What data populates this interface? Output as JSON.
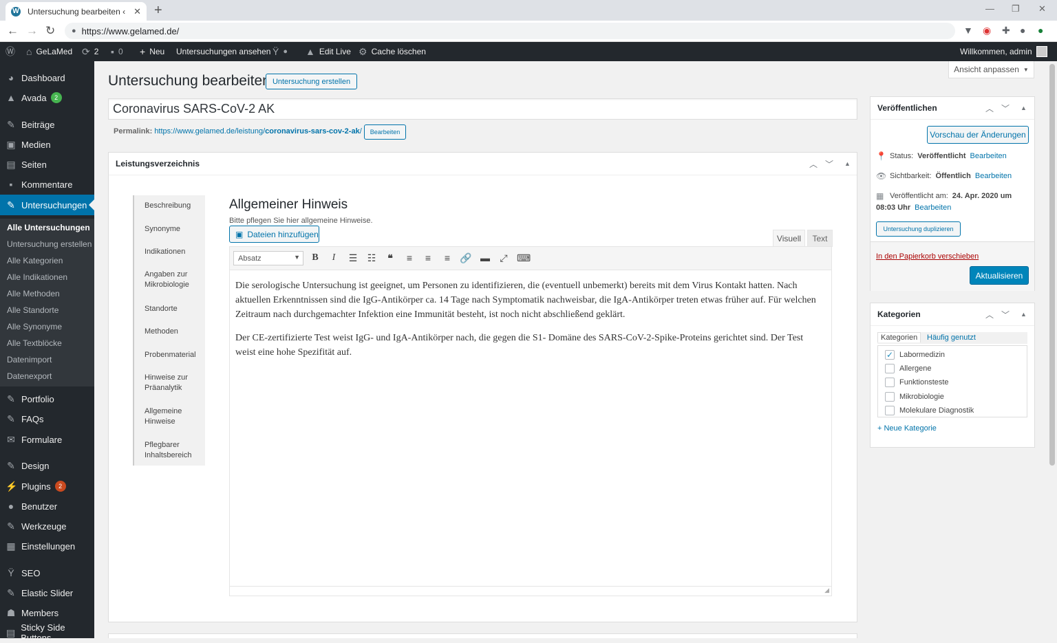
{
  "browser": {
    "tab_title": "Untersuchung bearbeiten ‹ GeLaMed",
    "tab_close": "✕",
    "new_tab": "+",
    "url": "https://www.gelamed.de/"
  },
  "adminbar": {
    "site_name": "GeLaMed",
    "updates_count": "2",
    "comments_count": "0",
    "new_label": "Neu",
    "view_label": "Untersuchungen ansehen",
    "edit_live_label": "Edit Live",
    "cache_label": "Cache löschen",
    "welcome": "Willkommen, admin"
  },
  "sidebar": {
    "dashboard": "Dashboard",
    "avada": "Avada",
    "avada_badge": "2",
    "beitraege": "Beiträge",
    "medien": "Medien",
    "seiten": "Seiten",
    "kommentare": "Kommentare",
    "untersuchungen": "Untersuchungen",
    "submenu": [
      "Alle Untersuchungen",
      "Untersuchung erstellen",
      "Alle Kategorien",
      "Alle Indikationen",
      "Alle Methoden",
      "Alle Standorte",
      "Alle Synonyme",
      "Alle Textblöcke",
      "Datenimport",
      "Datenexport"
    ],
    "portfolio": "Portfolio",
    "faqs": "FAQs",
    "formulare": "Formulare",
    "design": "Design",
    "plugins": "Plugins",
    "plugins_badge": "2",
    "benutzer": "Benutzer",
    "werkzeuge": "Werkzeuge",
    "einstellungen": "Einstellungen",
    "seo": "SEO",
    "elastic_slider": "Elastic Slider",
    "members": "Members",
    "sticky": "Sticky Side Buttons"
  },
  "screen_options": "Ansicht anpassen",
  "page": {
    "title": "Untersuchung bearbeiten",
    "add_new": "Untersuchung erstellen",
    "post_title": "Coronavirus SARS-CoV-2 AK",
    "permalink_label": "Permalink:",
    "permalink_base": "https://www.gelamed.de/leistung/",
    "permalink_slug": "coronavirus-sars-cov-2-ak",
    "permalink_end": "/",
    "permalink_edit": "Bearbeiten"
  },
  "metabox": {
    "title": "Leistungsverzeichnis",
    "tabs": [
      "Beschreibung",
      "Synonyme",
      "Indikationen",
      "Angaben zur Mikrobiologie",
      "Standorte",
      "Methoden",
      "Probenmaterial",
      "Hinweise zur Präanalytik",
      "Allgemeine Hinweise",
      "Pflegbarer Inhaltsbereich"
    ],
    "section_title": "Allgemeiner Hinweis",
    "section_desc": "Bitte pflegen Sie hier allgemeine Hinweise.",
    "add_media": "Dateien hinzufügen",
    "tab_visual": "Visuell",
    "tab_text": "Text",
    "format_select": "Absatz",
    "paragraph1": "Die serologische Untersuchung ist geeignet, um Personen zu identifizieren, die (eventuell unbemerkt) bereits mit dem Virus Kontakt hatten. Nach aktuellen Erkenntnissen sind die IgG-Antikörper ca. 14 Tage nach Symptomatik nachweisbar, die IgA-Antikörper treten etwas früher auf. Für welchen Zeitraum nach durchgemachter Infektion eine Immunität besteht, ist noch nicht abschließend geklärt.",
    "paragraph2": "Der CE-zertifizierte Test weist IgG- und IgA-Antikörper nach, die gegen die S1- Domäne des SARS-CoV-2-Spike-Proteins gerichtet sind. Der Test weist eine hohe Spezifität auf."
  },
  "publish": {
    "title": "Veröffentlichen",
    "preview": "Vorschau der Änderungen",
    "status_label": "Status:",
    "status_value": "Veröffentlicht",
    "visibility_label": "Sichtbarkeit:",
    "visibility_value": "Öffentlich",
    "published_label": "Veröffentlicht am:",
    "published_value": "24. Apr. 2020 um",
    "published_time": "08:03 Uhr",
    "edit": "Bearbeiten",
    "duplicate": "Untersuchung duplizieren",
    "trash": "In den Papierkorb verschieben",
    "update": "Aktualisieren"
  },
  "categories": {
    "title": "Kategorien",
    "tab_all": "Kategorien",
    "tab_popular": "Häufig genutzt",
    "items": [
      {
        "label": "Labormedizin",
        "checked": true
      },
      {
        "label": "Allergene",
        "checked": false
      },
      {
        "label": "Funktionsteste",
        "checked": false
      },
      {
        "label": "Mikrobiologie",
        "checked": false
      },
      {
        "label": "Molekulare Diagnostik",
        "checked": false
      }
    ],
    "new_category": "+ Neue Kategorie"
  },
  "colors": {
    "admin_dark": "#23282d",
    "accent": "#0073aa",
    "primary_button": "#0085ba",
    "badge_green": "#46b450",
    "badge_orange": "#ca4a1f",
    "trash_red": "#a00"
  }
}
